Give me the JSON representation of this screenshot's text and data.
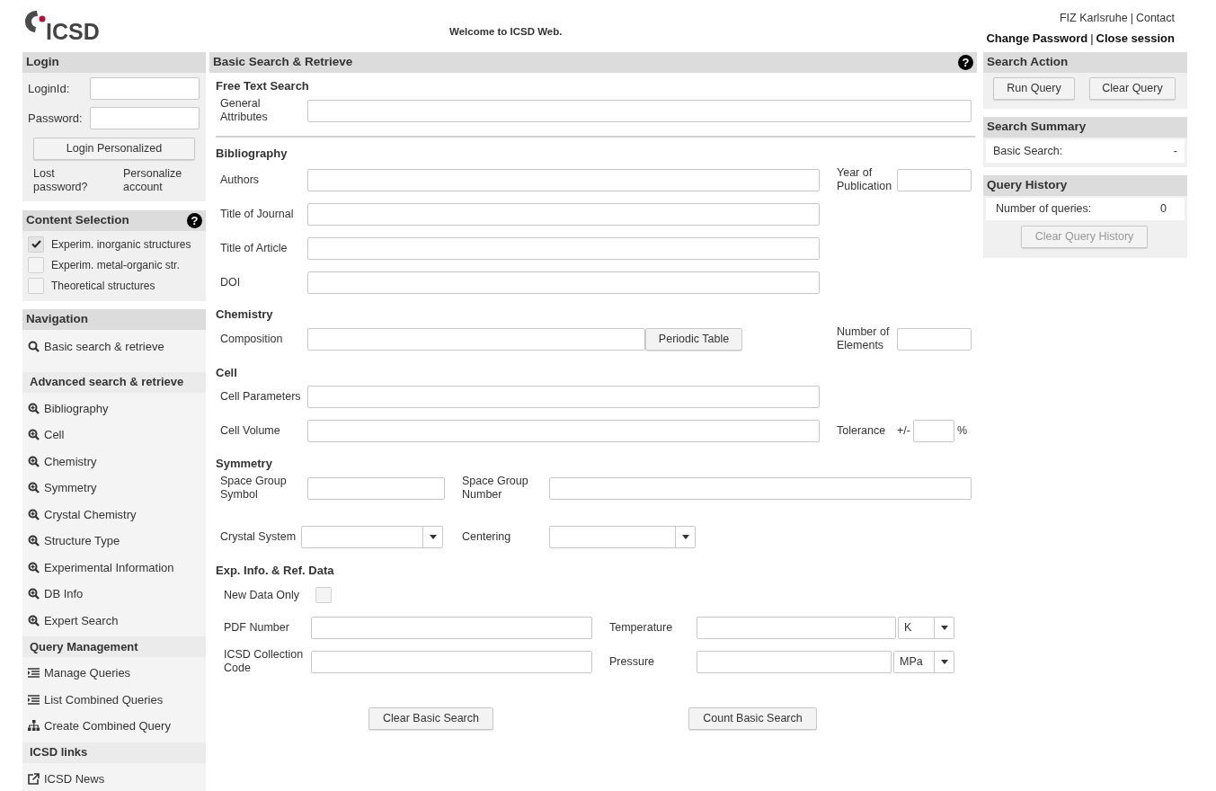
{
  "header": {
    "logo_text": "ICSD",
    "welcome": "Welcome to ICSD Web.",
    "top_links": [
      "FIZ Karlsruhe",
      "Contact"
    ],
    "top_separator": "|",
    "session_links": [
      "Change Password",
      "Close session"
    ],
    "session_separator": "|"
  },
  "login": {
    "title": "Login",
    "fields": [
      {
        "label": "LoginId:"
      },
      {
        "label": "Password:"
      }
    ],
    "button": "Login Personalized",
    "links": [
      "Lost password?",
      "Personalize account"
    ]
  },
  "content_selection": {
    "title": "Content Selection",
    "help": "?",
    "items": [
      {
        "label": "Experim. inorganic structures",
        "checked": true
      },
      {
        "label": "Experim. metal-organic str.",
        "checked": false
      },
      {
        "label": "Theoretical structures",
        "checked": false
      }
    ]
  },
  "navigation": {
    "title": "Navigation",
    "items": [
      {
        "kind": "search",
        "label": "Basic search & retrieve"
      },
      {
        "kind": "header",
        "label": "Advanced search & retrieve"
      },
      {
        "kind": "zoom",
        "label": "Bibliography"
      },
      {
        "kind": "zoom",
        "label": "Cell"
      },
      {
        "kind": "zoom",
        "label": "Chemistry"
      },
      {
        "kind": "zoom",
        "label": "Symmetry"
      },
      {
        "kind": "zoom",
        "label": "Crystal Chemistry"
      },
      {
        "kind": "zoom",
        "label": "Structure Type"
      },
      {
        "kind": "zoom",
        "label": "Experimental Information"
      },
      {
        "kind": "zoom",
        "label": "DB Info"
      },
      {
        "kind": "zoom",
        "label": "Expert Search"
      },
      {
        "kind": "header",
        "label": "Query Management"
      },
      {
        "kind": "list",
        "label": "Manage Queries"
      },
      {
        "kind": "list",
        "label": "List Combined Queries"
      },
      {
        "kind": "hierarchy",
        "label": "Create Combined Query"
      },
      {
        "kind": "header",
        "label": "ICSD links"
      },
      {
        "kind": "external",
        "label": "ICSD News"
      }
    ]
  },
  "main": {
    "title": "Basic Search & Retrieve",
    "help": "?",
    "free_text": {
      "heading": "Free Text Search",
      "general_attributes": "General Attributes"
    },
    "bibliography": {
      "heading": "Bibliography",
      "authors": "Authors",
      "year": "Year of Publication",
      "journal": "Title of Journal",
      "article": "Title of Article",
      "doi": "DOI"
    },
    "chemistry": {
      "heading": "Chemistry",
      "composition": "Composition",
      "periodic_table_button": "Periodic Table",
      "number_of_elements": "Number of Elements"
    },
    "cell": {
      "heading": "Cell",
      "parameters": "Cell Parameters",
      "volume": "Cell Volume",
      "tolerance": "Tolerance",
      "plus_minus": "+/-",
      "percent": "%"
    },
    "symmetry": {
      "heading": "Symmetry",
      "space_group_symbol": "Space Group Symbol",
      "space_group_number": "Space Group Number",
      "crystal_system": "Crystal System",
      "centering": "Centering"
    },
    "exp_info": {
      "heading": "Exp. Info. & Ref. Data",
      "new_data_only": {
        "label": "New Data Only",
        "checked": false
      },
      "pdf_number": "PDF Number",
      "temperature": "Temperature",
      "temperature_unit": "K",
      "icsd_code": "ICSD Collection Code",
      "pressure": "Pressure",
      "pressure_unit": "MPa"
    },
    "buttons": [
      "Clear Basic Search",
      "Count Basic Search"
    ]
  },
  "search_action": {
    "title": "Search Action",
    "buttons": [
      "Run Query",
      "Clear Query"
    ]
  },
  "search_summary": {
    "title": "Search Summary",
    "label": "Basic Search:",
    "value": "-"
  },
  "query_history": {
    "title": "Query History",
    "label": "Number of queries:",
    "value": "0",
    "button": {
      "label": "Clear Query History",
      "disabled": true
    }
  }
}
